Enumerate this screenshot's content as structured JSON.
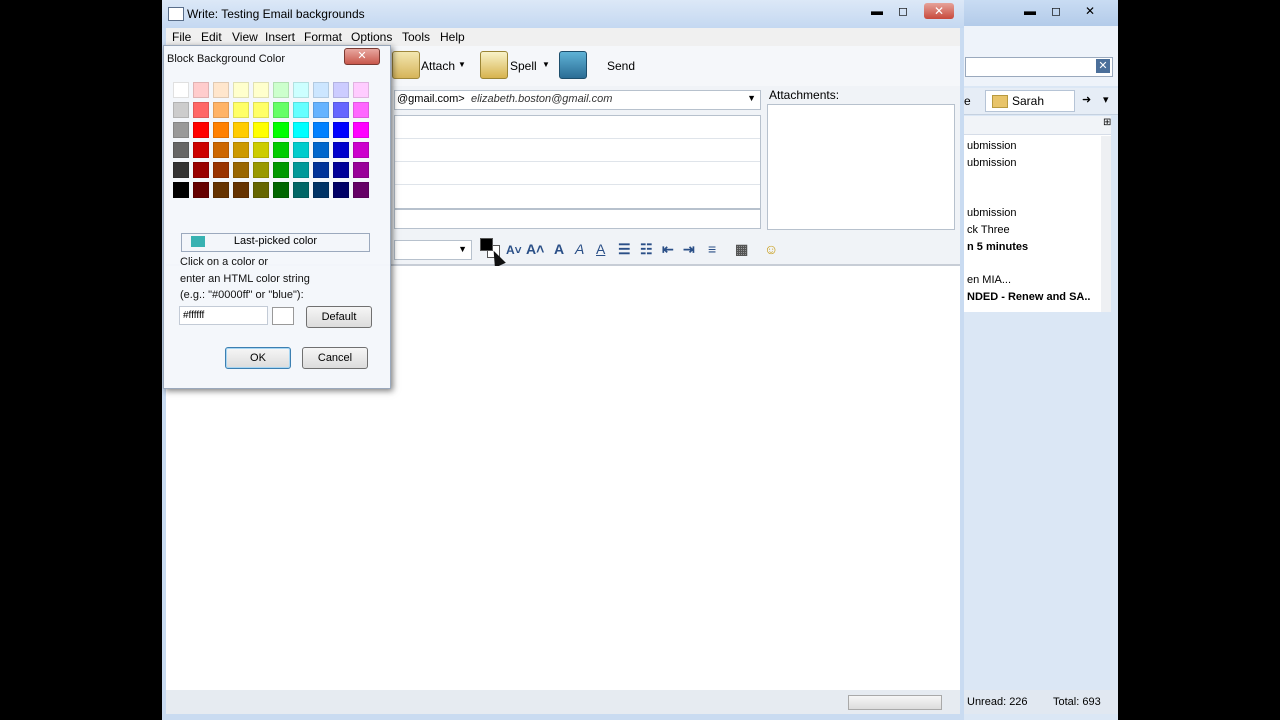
{
  "main_window": {
    "search_clear": "✕",
    "tabs": [
      "e",
      "Sarah"
    ],
    "tab_arrows": [
      "➜",
      "▾"
    ],
    "message_rows": [
      {
        "text": "ubmission",
        "bold": false
      },
      {
        "text": "ubmission",
        "bold": false
      },
      {
        "text": "",
        "bold": false
      },
      {
        "text": "ubmission",
        "bold": false
      },
      {
        "text": "ck Three",
        "bold": false
      },
      {
        "text": "n 5 minutes",
        "bold": true
      },
      {
        "text": "en MIA...",
        "bold": false
      },
      {
        "text": "NDED - Renew and SA...",
        "bold": true
      }
    ],
    "status": {
      "unread": "Unread: 226",
      "total": "Total: 693"
    }
  },
  "compose": {
    "title": "Write: Testing Email backgrounds",
    "menu": [
      "File",
      "Edit",
      "View",
      "Insert",
      "Format",
      "Options",
      "Tools",
      "Help"
    ],
    "toolbar": {
      "attach": "Attach",
      "spell": "Spell",
      "send": "Send"
    },
    "from_value": "@gmail.com>",
    "from_identity": "elizabeth.boston@gmail.com",
    "attachments_label": "Attachments:",
    "format_icons": [
      "A˅",
      "A˄",
      "A",
      "A",
      "A",
      "☰",
      "☷",
      "⇤",
      "⇥",
      "≡",
      "▦",
      "☺"
    ]
  },
  "dialog": {
    "title": "Block Background Color",
    "close": "✕",
    "last_picked_label": "Last-picked color",
    "instructions": [
      "Click on a color or",
      "enter an HTML color string",
      "(e.g.: \"#0000ff\" or \"blue\"):"
    ],
    "hex_value": "#ffffff",
    "default_label": "Default",
    "ok_label": "OK",
    "cancel_label": "Cancel",
    "swatch_rows": [
      [
        "#ffffff",
        "#ffcccc",
        "#ffe6cc",
        "#ffffcc",
        "#ffffcc",
        "#ccffcc",
        "#ccffff",
        "#cce6ff",
        "#ccccff",
        "#ffccff"
      ],
      [
        "#cccccc",
        "#ff6666",
        "#ffb366",
        "#ffff66",
        "#ffff66",
        "#66ff66",
        "#66ffff",
        "#66b3ff",
        "#6666ff",
        "#ff66ff"
      ],
      [
        "#999999",
        "#ff0000",
        "#ff8000",
        "#ffcc00",
        "#ffff00",
        "#00ff00",
        "#00ffff",
        "#0080ff",
        "#0000ff",
        "#ff00ff"
      ],
      [
        "#666666",
        "#cc0000",
        "#cc6600",
        "#cc9900",
        "#cccc00",
        "#00cc00",
        "#00cccc",
        "#0066cc",
        "#0000cc",
        "#cc00cc"
      ],
      [
        "#333333",
        "#990000",
        "#993300",
        "#996600",
        "#999900",
        "#009900",
        "#009999",
        "#003399",
        "#000099",
        "#990099"
      ],
      [
        "#000000",
        "#660000",
        "#663300",
        "#663300",
        "#666600",
        "#006600",
        "#006666",
        "#003366",
        "#000066",
        "#660066"
      ]
    ]
  }
}
